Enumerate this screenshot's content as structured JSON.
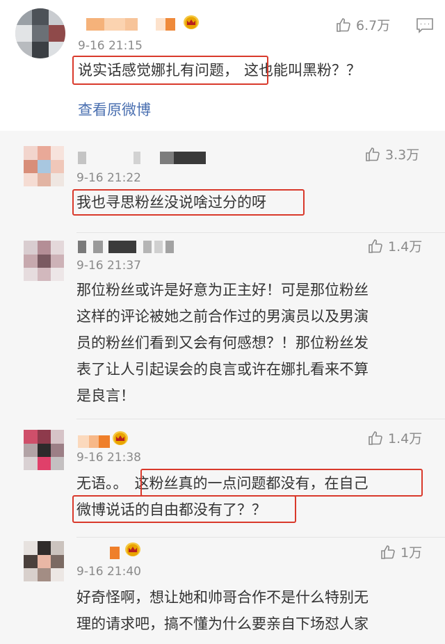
{
  "main_comment": {
    "time": "9-16 21:15",
    "likes": "6.7万",
    "text_highlight": "说实话感觉娜扎有问题，",
    "text_rest": "这也能叫黑粉？？",
    "view_original": "查看原微博"
  },
  "replies": [
    {
      "time": "9-16 21:22",
      "likes": "3.3万",
      "text_highlight": "我也寻思粉丝没说啥过分的呀"
    },
    {
      "time": "9-16 21:37",
      "likes": "1.4万",
      "lines": [
        "那位粉丝或许是好意为正主好！可是那位粉丝",
        "这样的评论被她之前合作过的男演员以及男演",
        "员的粉丝们看到又会有何感想？！那位粉丝发",
        "表了让人引起误会的良言或许在娜扎看来不算",
        "是良言！"
      ]
    },
    {
      "time": "9-16 21:38",
      "likes": "1.4万",
      "prefix": "无语。。",
      "highlight_line1": "这粉丝真的一点问题都没有，在自己",
      "highlight_line2": "微博说话的自由都没有了？？"
    },
    {
      "time": "9-16 21:40",
      "likes": "1万",
      "lines": [
        "好奇怪啊，想让她和帅哥合作不是什么特别无",
        "理的请求吧，搞不懂为什么要亲自下场怼人家"
      ]
    }
  ]
}
